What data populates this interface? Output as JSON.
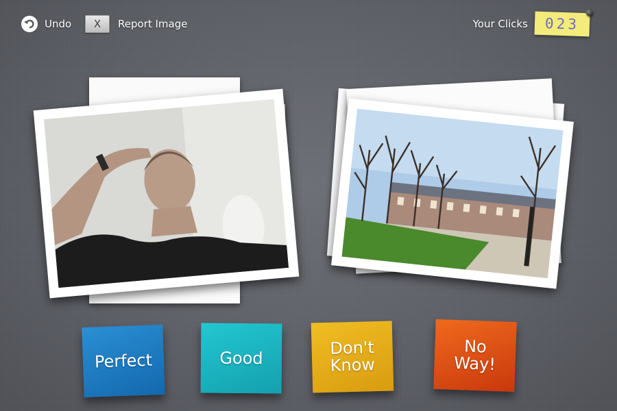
{
  "toolbar": {
    "undo_label": "Undo",
    "undo_icon": "undo-icon",
    "report_label": "Report Image",
    "report_icon_text": "X"
  },
  "clicks": {
    "label": "Your Clicks",
    "value": "023"
  },
  "photos": {
    "left": {
      "subject": "portrait-photo"
    },
    "right": {
      "subject": "park-photo"
    }
  },
  "ratings": [
    {
      "label": "Perfect",
      "color": "#1f7fc4"
    },
    {
      "label": "Good",
      "color": "#1bb5c0"
    },
    {
      "label": "Don't\nKnow",
      "color": "#e3ad16"
    },
    {
      "label": "No\nWay!",
      "color": "#df4e12"
    }
  ]
}
